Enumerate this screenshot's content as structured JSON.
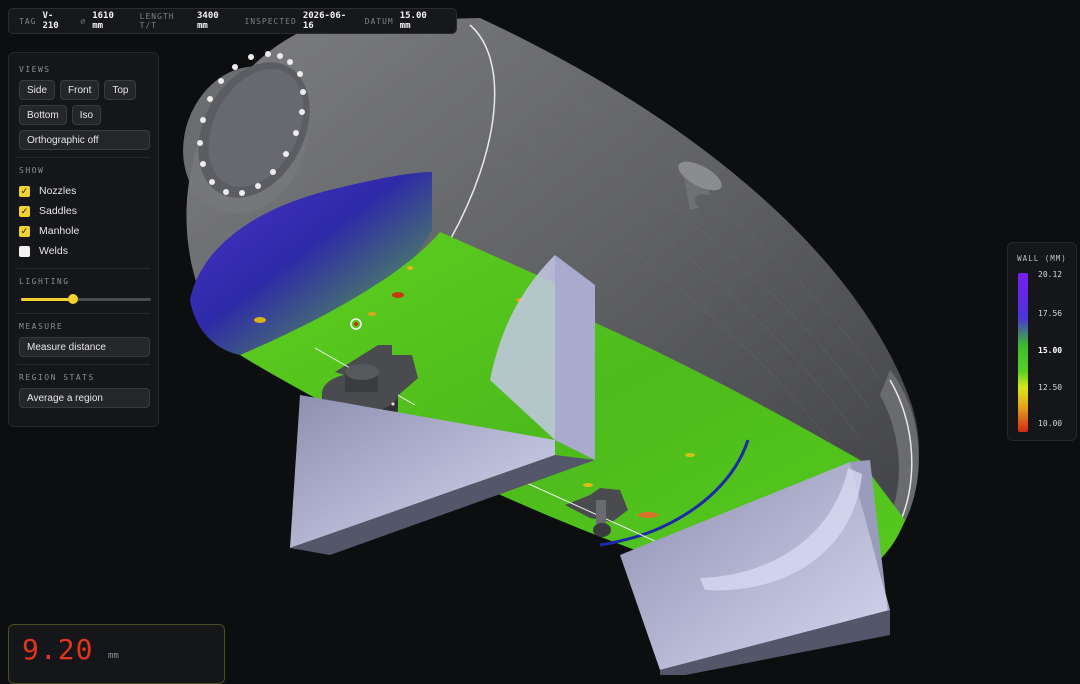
{
  "header": {
    "tag_label": "TAG",
    "tag_value": "V-210",
    "dia_label": "⌀",
    "dia_value": "1610 mm",
    "length_label": "LENGTH T/T",
    "length_value": "3400 mm",
    "inspected_label": "INSPECTED",
    "inspected_value": "2026-06-16",
    "datum_label": "DATUM",
    "datum_value": "15.00 mm"
  },
  "panel": {
    "views_title": "VIEWS",
    "views": [
      "Side",
      "Front",
      "Top",
      "Bottom",
      "Iso"
    ],
    "ortho_label": "Orthographic off",
    "show_title": "SHOW",
    "show_items": [
      {
        "label": "Nozzles",
        "checked": true
      },
      {
        "label": "Saddles",
        "checked": true
      },
      {
        "label": "Manhole",
        "checked": true
      },
      {
        "label": "Welds",
        "checked": false
      }
    ],
    "lighting_title": "LIGHTING",
    "lighting_level": 0.4,
    "measure_title": "MEASURE",
    "measure_label": "Measure distance",
    "region_title": "REGION STATS",
    "region_label": "Average a region"
  },
  "legend": {
    "title": "WALL (MM)",
    "ticks": [
      "20.12",
      "17.56",
      "15.00",
      "12.50",
      "10.00"
    ]
  },
  "readout": {
    "value": "9.20",
    "unit": "mm"
  },
  "colors": {
    "accent": "#f2d22e",
    "readout": "#e3341e",
    "nominal": "#59d126",
    "thick": "#4a34d8",
    "thin": "#d42a14"
  }
}
